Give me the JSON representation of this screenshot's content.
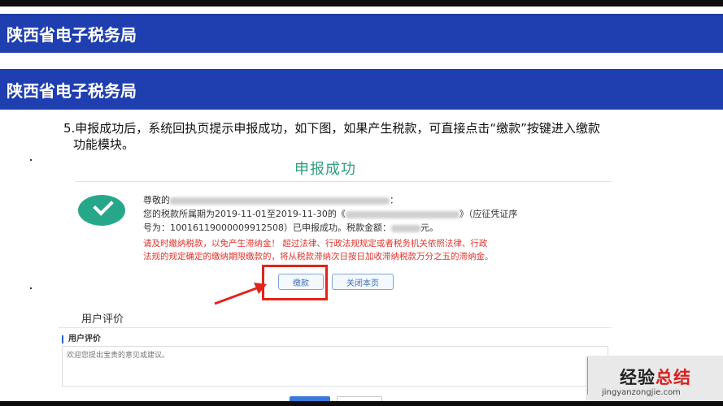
{
  "header": {
    "title_1": "陕西省电子税务局",
    "title_2": "陕西省电子税务局"
  },
  "instruction": {
    "line_1": "5.申报成功后，系统回执页提示申报成功，如下图，如果产生税款，可直接点击“缴款”按键进入缴款",
    "line_2": "功能模块。"
  },
  "screenshot": {
    "title": "申报成功",
    "greeting_prefix": "尊敬的",
    "greeting_suffix": "：",
    "period_text": "您的税款所属期为2019-11-01至2019-11-30的《",
    "voucher_suffix": "》（应征凭证序",
    "line3_prefix": "号为：10016119000009912508）已申报成功。税款金额：",
    "amount_suffix": "元。",
    "warning_line_1": "请及时缴纳税款，以免产生滞纳金！ 超过法律、行政法规规定或者税务机关依照法律、行政",
    "warning_line_2": "法规的规定确定的缴纳期限缴款的，将从税款滞纳次日按日加收滞纳税款万分之五的滞纳金。",
    "pay_button": "缴款",
    "close_button": "关闭本页",
    "rating_heading": "用户评价",
    "rating_label": "用户评价",
    "rating_placeholder": "欢迎您提出宝贵的意见或建议。"
  },
  "watermark": {
    "text_black": "经验",
    "text_red": "总结",
    "url": "jingyanzongjie.com"
  },
  "colors": {
    "header_blue": "#1f3fb0",
    "success_green": "#27a78a",
    "warning_red": "#e0332c",
    "highlight_red": "#e2231a"
  }
}
